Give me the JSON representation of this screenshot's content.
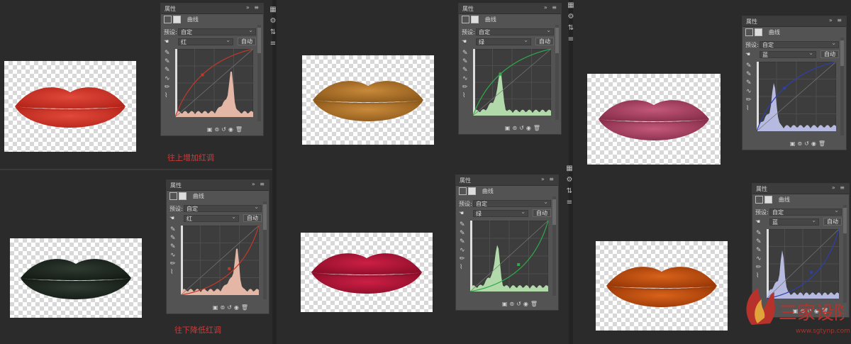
{
  "panels": [
    {
      "id": "p1",
      "title": "属性",
      "mode": "曲线",
      "preset_label": "预设:",
      "preset": "自定",
      "channel": "红",
      "auto": "自动",
      "color": "#c0392b",
      "hist": "#f5c3b0",
      "curve": "up"
    },
    {
      "id": "p2",
      "title": "属性",
      "mode": "曲线",
      "preset_label": "预设:",
      "preset": "自定",
      "channel": "红",
      "auto": "自动",
      "color": "#c0392b",
      "hist": "#f5c3b0",
      "curve": "down"
    },
    {
      "id": "p3",
      "title": "属性",
      "mode": "曲线",
      "preset_label": "预设:",
      "preset": "自定",
      "channel": "绿",
      "auto": "自动",
      "color": "#2fa94a",
      "hist": "#bfeab6",
      "curve": "up"
    },
    {
      "id": "p4",
      "title": "属性",
      "mode": "曲线",
      "preset_label": "预设:",
      "preset": "自定",
      "channel": "绿",
      "auto": "自动",
      "color": "#2fa94a",
      "hist": "#bfeab6",
      "curve": "down"
    },
    {
      "id": "p5",
      "title": "属性",
      "mode": "曲线",
      "preset_label": "预设:",
      "preset": "自定",
      "channel": "蓝",
      "auto": "自动",
      "color": "#2f3fa9",
      "hist": "#c4c8f2",
      "curve": "up"
    },
    {
      "id": "p6",
      "title": "属性",
      "mode": "曲线",
      "preset_label": "预设:",
      "preset": "自定",
      "channel": "蓝",
      "auto": "自动",
      "color": "#2f3fa9",
      "hist": "#c4c8f2",
      "curve": "down"
    }
  ],
  "captions": {
    "up": "往上增加红调",
    "down": "往下降低红调"
  },
  "lips": [
    {
      "id": "l1",
      "color": "#e0493b",
      "shade": "#b8261b"
    },
    {
      "id": "l2",
      "color": "#2e3a30",
      "shade": "#151c16"
    },
    {
      "id": "l3",
      "color": "#c98a3a",
      "shade": "#8e5a1c"
    },
    {
      "id": "l4",
      "color": "#cc1f45",
      "shade": "#8e0e2a"
    },
    {
      "id": "l5",
      "color": "#c3587a",
      "shade": "#8a2f4d"
    },
    {
      "id": "l6",
      "color": "#d8621a",
      "shade": "#9c3a08"
    }
  ],
  "watermark": {
    "site": "www.sgtynp.com",
    "logo_text": "三家设院"
  }
}
